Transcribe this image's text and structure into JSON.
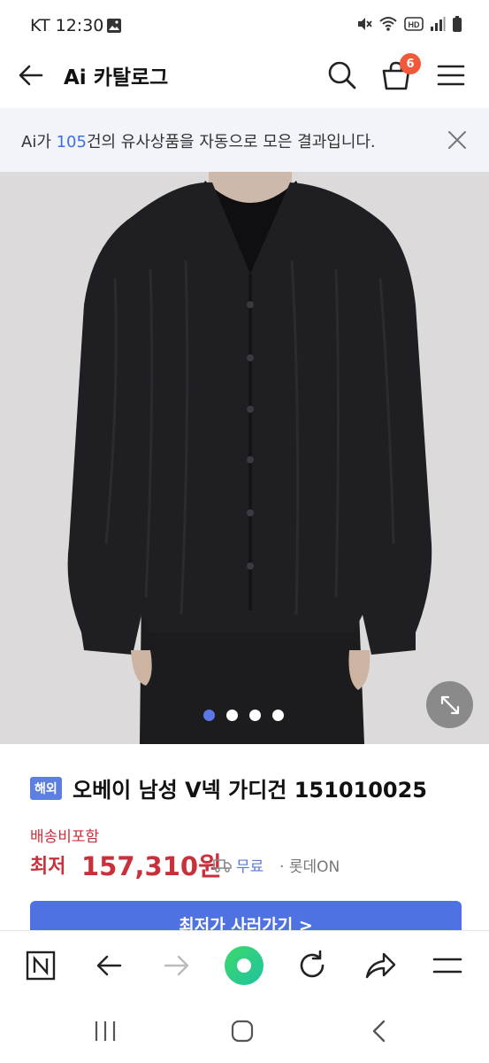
{
  "status_bar": {
    "carrier_time": "KT 12:30",
    "icons": [
      "gallery-icon",
      "mute-icon",
      "wifi-icon",
      "hd-icon",
      "signal-icon",
      "battery-icon"
    ]
  },
  "header": {
    "title": "Ai 카탈로그",
    "cart_count": "6"
  },
  "banner": {
    "prefix": "Ai가 ",
    "count": "105",
    "suffix": "건의 유사상품을 자동으로 모은 결과입니다."
  },
  "gallery": {
    "slide_count": 4,
    "active_index": 0
  },
  "product": {
    "tag": "해외",
    "name": "오베이 남성 V넥 가디건 151010025",
    "shipping": "배송비포함",
    "lowest_label": "최저",
    "price": "157,310원",
    "free_shipping": "무료",
    "separator": "·",
    "seller": "롯데ON",
    "buy_button": "최저가 사러가기 >"
  },
  "browser_toolbar": {
    "items": [
      "naver-home-icon",
      "back-icon",
      "forward-icon",
      "green-dot-icon",
      "reload-icon",
      "share-icon",
      "menu-icon"
    ]
  },
  "colors": {
    "accent_blue": "#4f72e2",
    "price_red": "#c8303b",
    "badge_orange": "#f05a3a"
  }
}
